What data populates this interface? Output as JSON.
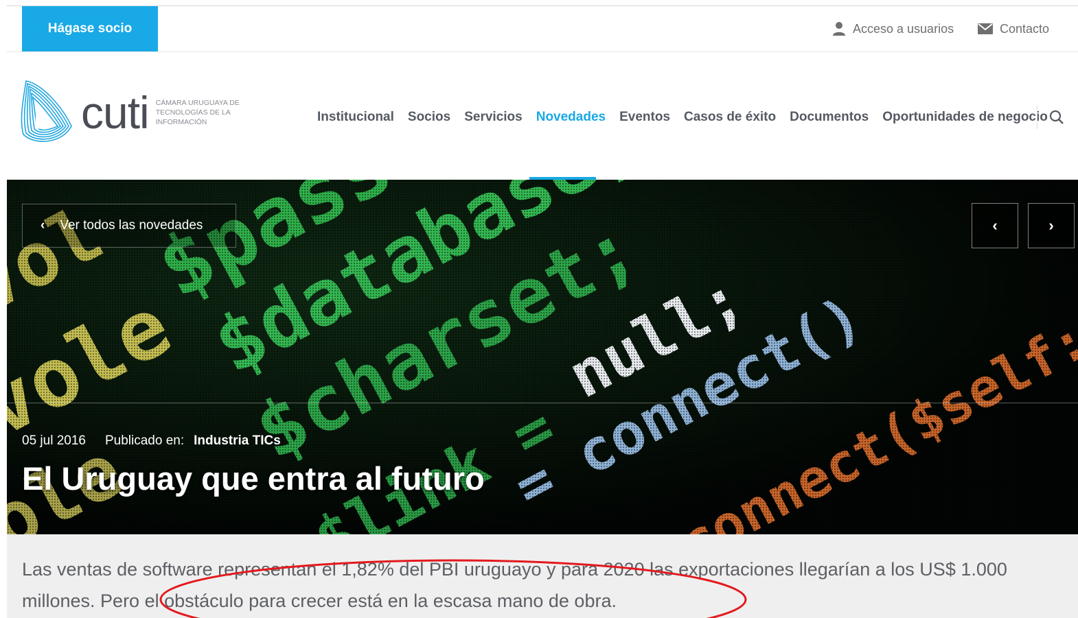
{
  "topbar": {
    "join_label": "Hágase socio",
    "users_label": "Acceso a usuarios",
    "contact_label": "Contacto"
  },
  "logo": {
    "word": "cuti",
    "tagline": "CÁMARA URUGUAYA DE TECNOLOGÍAS DE LA INFORMACIÓN"
  },
  "nav": {
    "items": [
      {
        "label": "Institucional"
      },
      {
        "label": "Socios"
      },
      {
        "label": "Servicios"
      },
      {
        "label": "Novedades",
        "active": true
      },
      {
        "label": "Eventos"
      },
      {
        "label": "Casos de éxito"
      },
      {
        "label": "Documentos"
      },
      {
        "label": "Oportunidades de negocio"
      }
    ]
  },
  "hero": {
    "back_label": "Ver todos las novedades",
    "date": "05  jul  2016",
    "published_in": "Publicado en:",
    "category": "Industria TICs",
    "title": "El Uruguay que entra al futuro",
    "code_words": [
      "$pass",
      "$database;",
      "$charset;",
      "null;",
      "= connect()",
      "connect($self::$host",
      "$link ="
    ]
  },
  "lead": {
    "text": "Las ventas de software representan el 1,82% del PBI uruguayo y para 2020 las exportaciones llegarían a los US$ 1.000 millones. Pero el obstáculo para crecer está en la escasa mano de obra."
  },
  "colors": {
    "accent": "#18a9e6",
    "nav_text": "#555a62",
    "annotation": "#e3191e"
  }
}
